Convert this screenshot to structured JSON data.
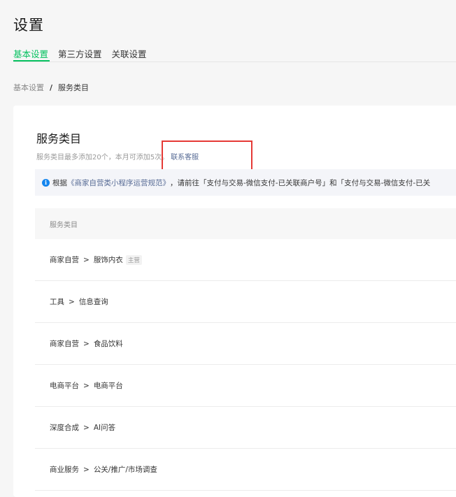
{
  "page": {
    "title": "设置"
  },
  "tabs": [
    {
      "label": "基本设置",
      "active": true
    },
    {
      "label": "第三方设置",
      "active": false
    },
    {
      "label": "关联设置",
      "active": false
    }
  ],
  "breadcrumb": {
    "parent": "基本设置",
    "separator": "/",
    "current": "服务类目"
  },
  "card": {
    "title": "服务类目",
    "description": "服务类目最多添加20个，本月可添加5次。",
    "contact_link": "联系客服"
  },
  "notice": {
    "icon": "info-icon",
    "prefix": "根据",
    "policy_link": "《商家自营类小程序运营规范》",
    "text": "，请前往「支付与交易-微信支付-已关联商户号」和「支付与交易-微信支付-已关"
  },
  "table": {
    "header": "服务类目",
    "rows": [
      {
        "primary": "商家自营",
        "separator": ">",
        "secondary": "服饰内衣",
        "tag": "主营"
      },
      {
        "primary": "工具",
        "separator": ">",
        "secondary": "信息查询",
        "tag": ""
      },
      {
        "primary": "商家自营",
        "separator": ">",
        "secondary": "食品饮料",
        "tag": ""
      },
      {
        "primary": "电商平台",
        "separator": ">",
        "secondary": "电商平台",
        "tag": ""
      },
      {
        "primary": "深度合成",
        "separator": ">",
        "secondary": "AI问答",
        "tag": ""
      },
      {
        "primary": "商业服务",
        "separator": ">",
        "secondary": "公关/推广/市场调查",
        "tag": ""
      }
    ]
  },
  "colors": {
    "accent": "#07c160",
    "link": "#576b95",
    "info": "#1485ee",
    "highlight": "#e53935"
  }
}
